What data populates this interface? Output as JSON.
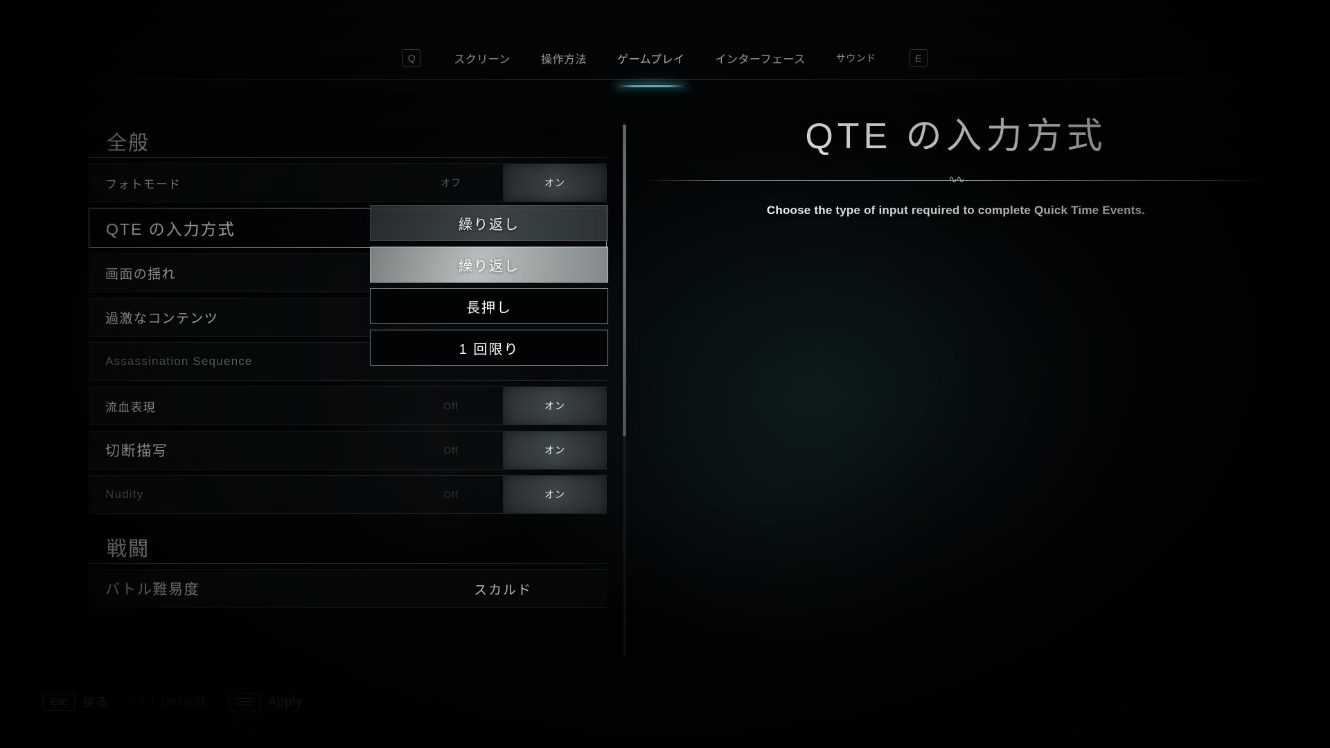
{
  "tabs": {
    "prev_key": "Q",
    "next_key": "E",
    "items": [
      {
        "label": "スクリーン"
      },
      {
        "label": "操作方法"
      },
      {
        "label": "ゲームプレイ"
      },
      {
        "label": "インターフェース"
      },
      {
        "label": "サウンド"
      }
    ]
  },
  "sections": [
    {
      "title": "全般",
      "rows": [
        {
          "label": "フォトモード",
          "type": "toggle",
          "off": "オフ",
          "on": "オン",
          "value": "オン"
        },
        {
          "label": "QTE の入力方式",
          "type": "value",
          "value": "繰り返し"
        },
        {
          "label": "画面の揺れ",
          "type": "value",
          "value": "繰り返し"
        },
        {
          "label": "過激なコンテンツ",
          "type": "value",
          "value": "長押し"
        },
        {
          "label": "Assassination Sequence",
          "type": "value",
          "value": "1 回限り"
        },
        {
          "label": "流血表現",
          "type": "toggle",
          "off": "Off",
          "on": "オン",
          "value": "オン"
        },
        {
          "label": "切断描写",
          "type": "toggle",
          "off": "Off",
          "on": "オン",
          "value": "オン"
        },
        {
          "label": "Nudity",
          "type": "toggle",
          "off": "Off",
          "on": "オン",
          "value": "オン"
        }
      ]
    },
    {
      "title": "戦闘",
      "rows": [
        {
          "label": "バトル難易度",
          "type": "value",
          "value": "スカルド"
        }
      ]
    }
  ],
  "dropdown": {
    "options": [
      {
        "label": "繰り返し",
        "state": "selected"
      },
      {
        "label": "繰り返し",
        "state": "highlighted"
      },
      {
        "label": "長押し",
        "state": "normal"
      },
      {
        "label": "1 回限り",
        "state": "normal"
      }
    ]
  },
  "detail": {
    "title": "QTE の入力方式",
    "description": "Choose the type of input required to complete Quick Time Events."
  },
  "bottom_bar": {
    "back": {
      "key": "Esc",
      "label": "戻る"
    },
    "default": {
      "key": "R",
      "label": "Default"
    },
    "apply": {
      "key": "enter-key-icon",
      "label": "Apply"
    }
  },
  "colors": {
    "accent": "#58e4ee",
    "text": "#f2f6f7",
    "dim_text": "#7e878b"
  }
}
